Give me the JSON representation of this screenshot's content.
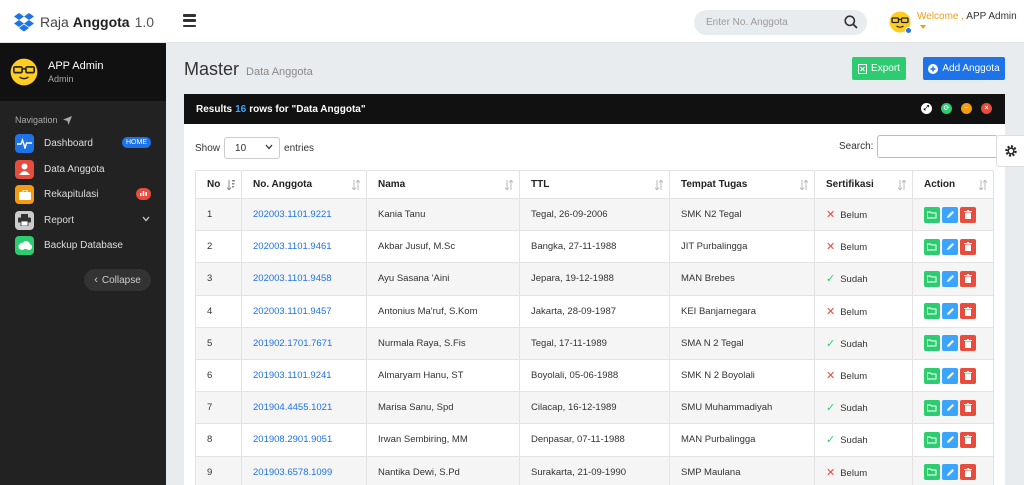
{
  "app": {
    "brand_light": "Raja",
    "brand_bold": "Anggota",
    "version": "1.0"
  },
  "topbar": {
    "search_placeholder": "Enter No. Anggota",
    "welcome": "Welcome ,",
    "user": "APP Admin"
  },
  "sidebar": {
    "profile_name": "APP Admin",
    "profile_role": "Admin",
    "nav_label": "Navigation",
    "items": [
      {
        "label": "Dashboard",
        "badge": "HOME",
        "color": "#1e73e8"
      },
      {
        "label": "Data Anggota",
        "color": "#e74c3c"
      },
      {
        "label": "Rekapitulasi",
        "color": "#f39c12"
      },
      {
        "label": "Report",
        "color": "#cccccc"
      },
      {
        "label": "Backup Database",
        "color": "#2ecc71"
      }
    ],
    "collapse": "Collapse"
  },
  "page": {
    "title": "Master",
    "subtitle": "Data Anggota",
    "export": "Export",
    "add": "Add Anggota"
  },
  "panel": {
    "results_pre": "Results",
    "results_count": "16",
    "results_post": "rows for \"Data Anggota\"",
    "show": "Show",
    "entries_value": "10",
    "entries": "entries",
    "search": "Search:"
  },
  "table": {
    "headers": [
      "No",
      "No. Anggota",
      "Nama",
      "TTL",
      "Tempat Tugas",
      "Sertifikasi",
      "Action"
    ],
    "rows": [
      [
        "1",
        "202003.1101.9221",
        "Kania Tanu",
        "Tegal, 26-09-2006",
        "SMK N2 Tegal",
        "Belum"
      ],
      [
        "2",
        "202003.1101.9461",
        "Akbar Jusuf, M.Sc",
        "Bangka, 27-11-1988",
        "JIT Purbalingga",
        "Belum"
      ],
      [
        "3",
        "202003.1101.9458",
        "Ayu Sasana 'Aini",
        "Jepara, 19-12-1988",
        "MAN Brebes",
        "Sudah"
      ],
      [
        "4",
        "202003.1101.9457",
        "Antonius Ma'ruf, S.Kom",
        "Jakarta, 28-09-1987",
        "KEI Banjarnegara",
        "Belum"
      ],
      [
        "5",
        "201902.1701.7671",
        "Nurmala Raya, S.Fis",
        "Tegal, 17-11-1989",
        "SMA N 2 Tegal",
        "Sudah"
      ],
      [
        "6",
        "201903.1101.9241",
        "Almaryam Hanu, ST",
        "Boyolali, 05-06-1988",
        "SMK N 2 Boyolali",
        "Belum"
      ],
      [
        "7",
        "201904.4455.1021",
        "Marisa Sanu, Spd",
        "Cilacap, 16-12-1989",
        "SMU Muhammadiyah",
        "Sudah"
      ],
      [
        "8",
        "201908.2901.9051",
        "Irwan Sembiring, MM",
        "Denpasar, 07-11-1988",
        "MAN Purbalingga",
        "Sudah"
      ],
      [
        "9",
        "201903.6578.1099",
        "Nantika Dewi, S.Pd",
        "Surakarta, 21-09-1990",
        "SMP Maulana",
        "Belum"
      ]
    ]
  }
}
